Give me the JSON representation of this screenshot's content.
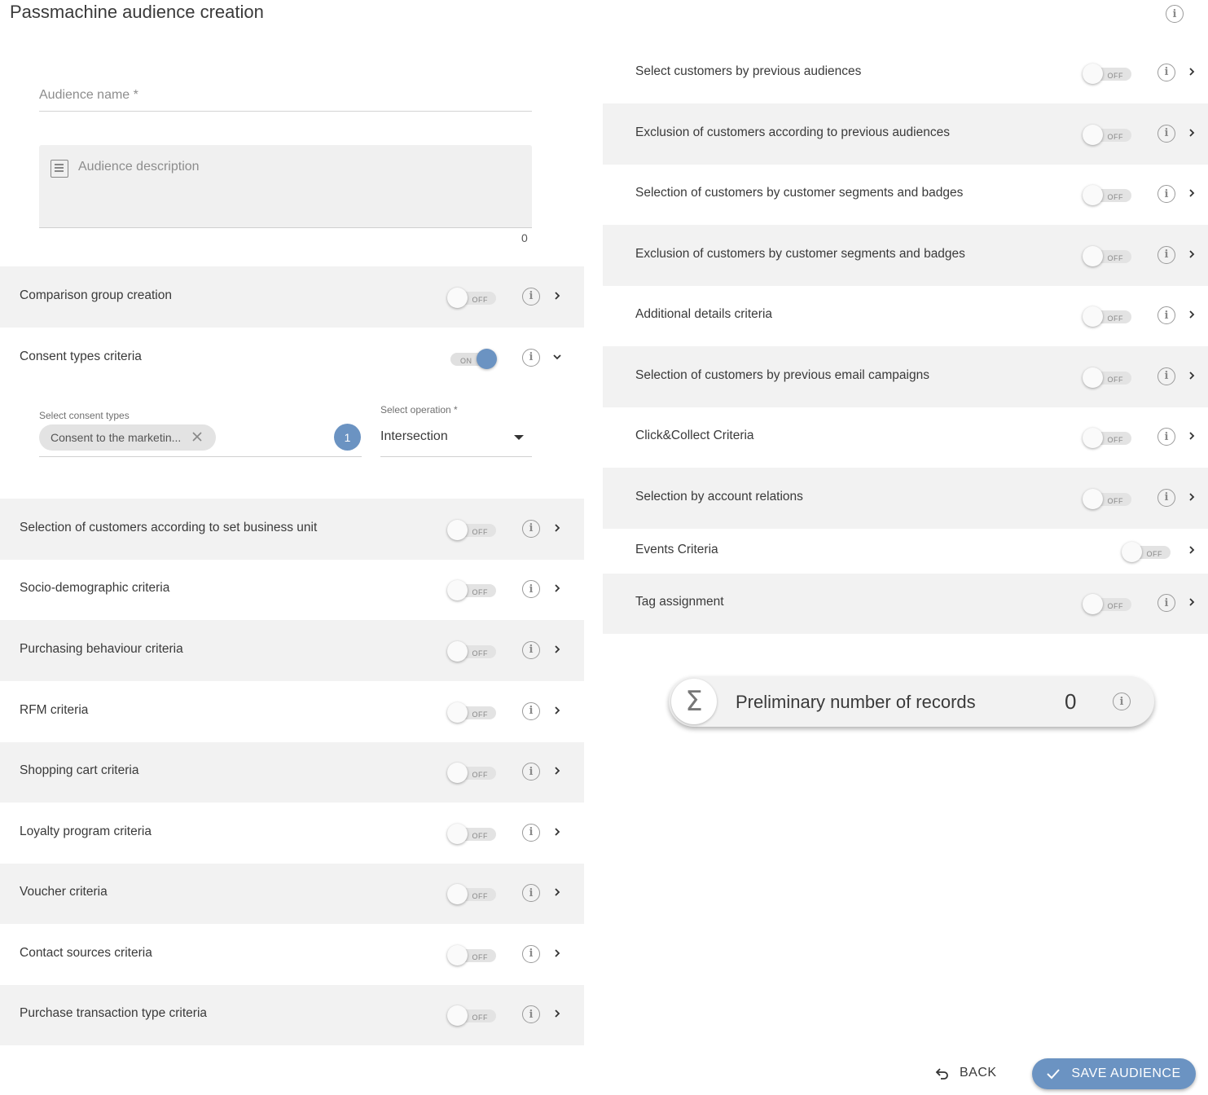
{
  "page": {
    "title": "Passmachine audience creation"
  },
  "form": {
    "name_placeholder": "Audience name *",
    "description_placeholder": "Audience description",
    "description_count": "0"
  },
  "toggle_text": {
    "off": "OFF",
    "on": "ON"
  },
  "left_rows": [
    {
      "label": "Comparison group creation",
      "state": "off"
    },
    {
      "label": "Consent types criteria",
      "state": "on",
      "expanded": true
    },
    {
      "label": "Selection of customers according to set business unit",
      "state": "off"
    },
    {
      "label": "Socio-demographic criteria",
      "state": "off"
    },
    {
      "label": "Purchasing behaviour criteria",
      "state": "off"
    },
    {
      "label": "RFM criteria",
      "state": "off"
    },
    {
      "label": "Shopping cart criteria",
      "state": "off"
    },
    {
      "label": "Loyalty program criteria",
      "state": "off"
    },
    {
      "label": "Voucher criteria",
      "state": "off"
    },
    {
      "label": "Contact sources criteria",
      "state": "off"
    },
    {
      "label": "Purchase transaction type criteria",
      "state": "off"
    }
  ],
  "consent": {
    "types_label": "Select consent types",
    "chip_text": "Consent to the marketin...",
    "count": "1",
    "operation_label": "Select operation *",
    "operation_value": "Intersection"
  },
  "right_rows": [
    {
      "label": "Select customers by previous audiences",
      "state": "off"
    },
    {
      "label": "Exclusion of customers according to previous audiences",
      "state": "off"
    },
    {
      "label": "Selection of customers by customer segments and badges",
      "state": "off"
    },
    {
      "label": "Exclusion of customers by customer segments and badges",
      "state": "off"
    },
    {
      "label": "Additional details criteria",
      "state": "off"
    },
    {
      "label": "Selection of customers by previous email campaigns",
      "state": "off"
    },
    {
      "label": "Click&Collect Criteria",
      "state": "off"
    },
    {
      "label": "Selection by account relations",
      "state": "off"
    },
    {
      "label": "Events Criteria",
      "state": "off",
      "no_info": true
    },
    {
      "label": "Tag assignment",
      "state": "off"
    }
  ],
  "preliminary": {
    "label": "Preliminary number of records",
    "value": "0",
    "icon": "sigma-icon"
  },
  "actions": {
    "back_label": "BACK",
    "save_label": "SAVE AUDIENCE"
  },
  "colors": {
    "accent": "#6b93c2",
    "row_shade": "#f2f2f2"
  }
}
